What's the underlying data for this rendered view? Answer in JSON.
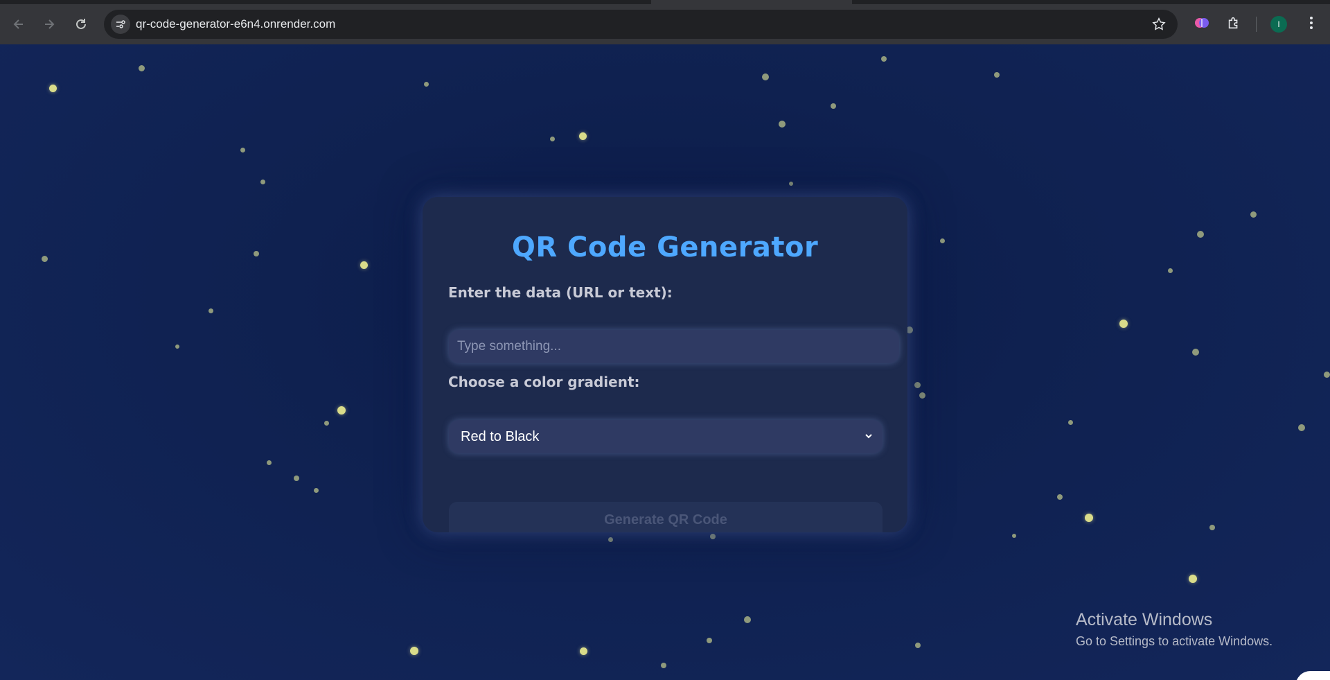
{
  "browser": {
    "url": "qr-code-generator-e6n4.onrender.com",
    "icons": [
      "back-icon",
      "forward-icon",
      "reload-icon",
      "site-settings-icon",
      "bookmark-star-icon",
      "extension-brain-icon",
      "extensions-puzzle-icon",
      "more-menu-icon"
    ],
    "profile_initial": "I",
    "profile_color": "#0b6b52"
  },
  "app": {
    "title": "QR Code Generator",
    "data_label": "Enter the data (URL or text):",
    "data_placeholder": "Type something...",
    "data_value": "",
    "gradient_label": "Choose a color gradient:",
    "gradient_selected": "Red to Black",
    "generate_label": "Generate QR Code",
    "title_color": "#4ea8ff"
  },
  "os_watermark": {
    "line1": "Activate Windows",
    "line2": "Go to Settings to activate Windows."
  }
}
